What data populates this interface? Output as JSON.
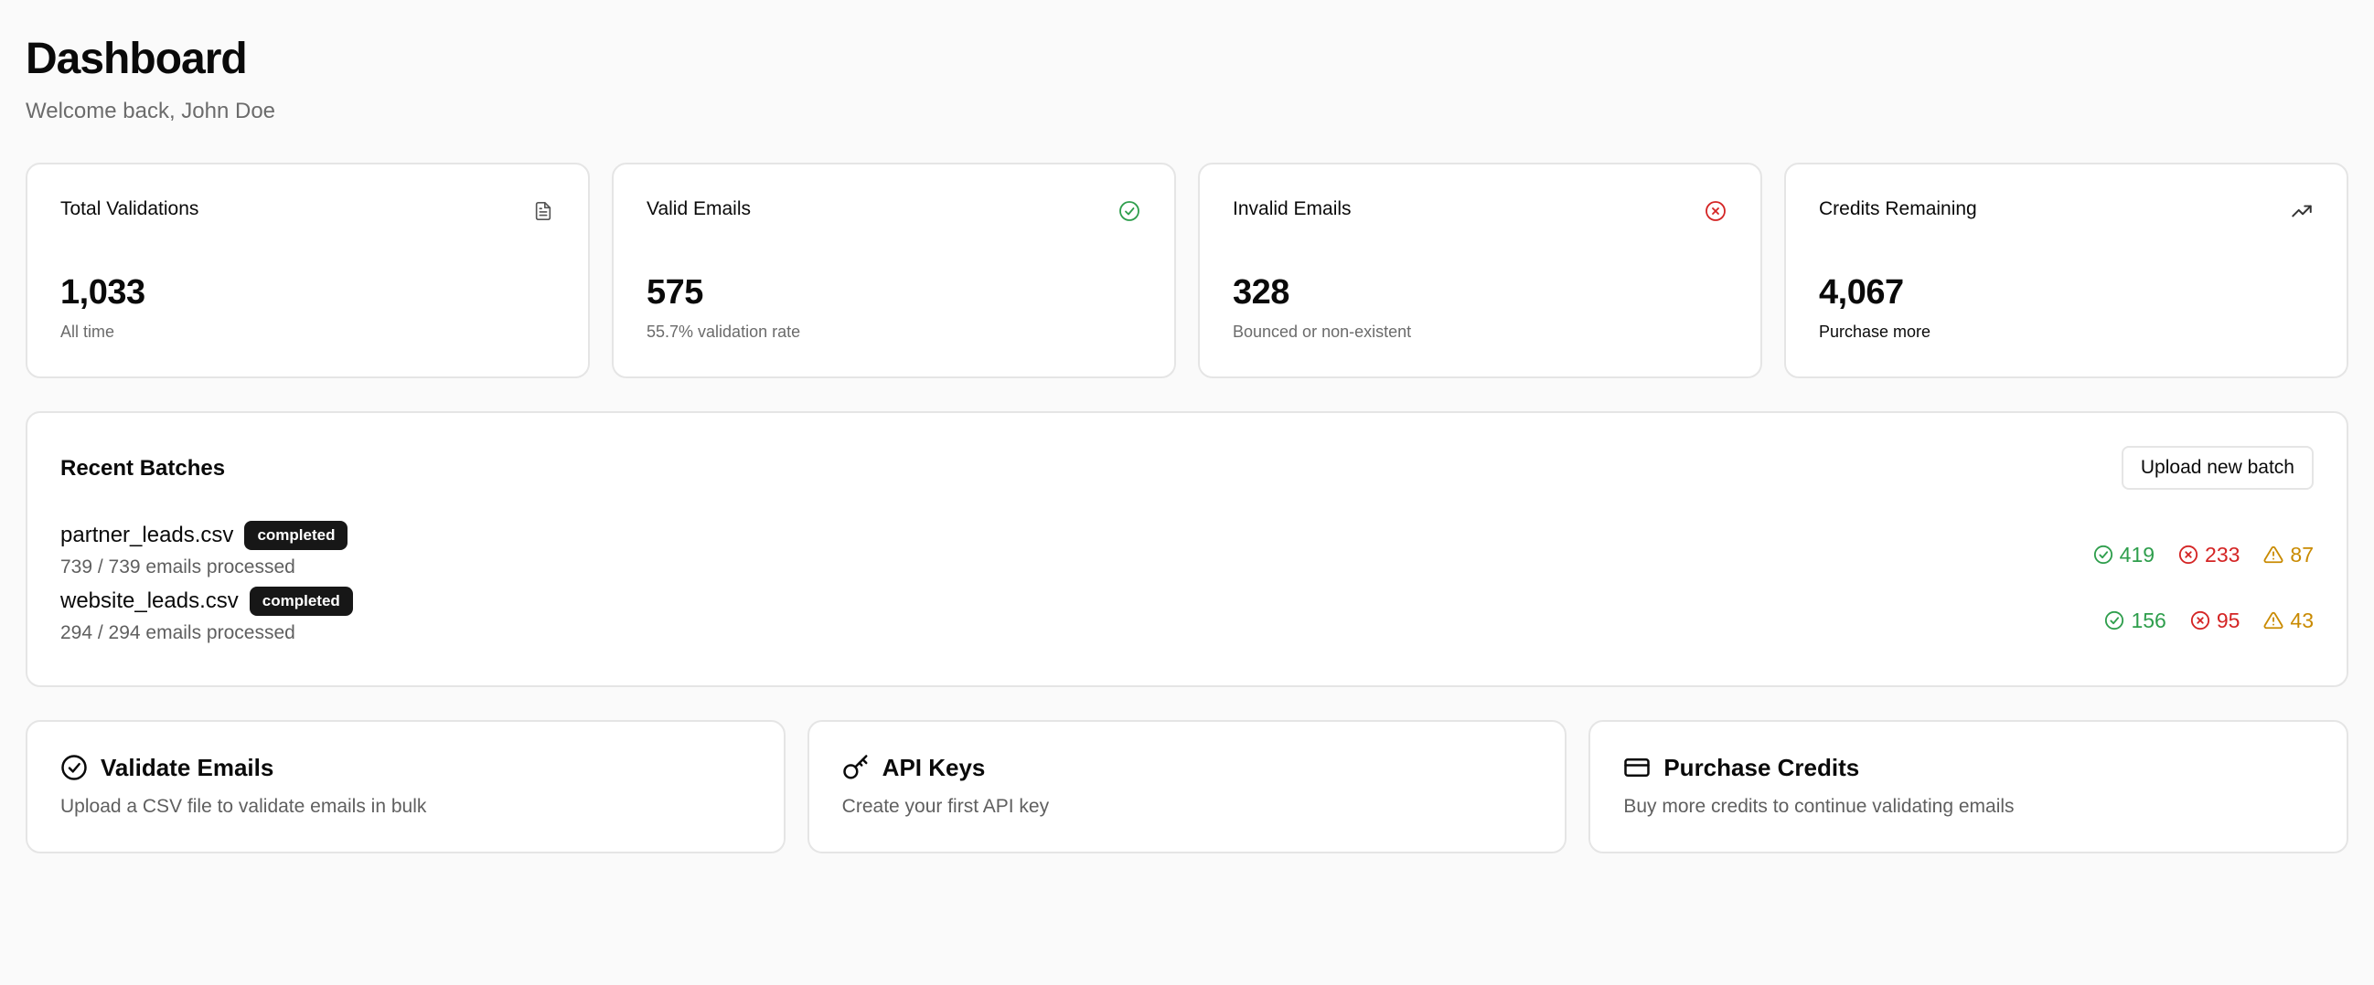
{
  "header": {
    "title": "Dashboard",
    "subtitle": "Welcome back, John Doe"
  },
  "stats": [
    {
      "title": "Total Validations",
      "value": "1,033",
      "sub": "All time",
      "icon": "document-icon"
    },
    {
      "title": "Valid Emails",
      "value": "575",
      "sub": "55.7% validation rate",
      "icon": "check-circle-icon",
      "color": "#2e9e4c"
    },
    {
      "title": "Invalid Emails",
      "value": "328",
      "sub": "Bounced or non-existent",
      "icon": "x-circle-icon",
      "color": "#d42424"
    },
    {
      "title": "Credits Remaining",
      "value": "4,067",
      "link": "Purchase more",
      "icon": "trending-up-icon"
    }
  ],
  "batches": {
    "title": "Recent Batches",
    "upload_label": "Upload new batch",
    "items": [
      {
        "name": "partner_leads.csv",
        "status": "completed",
        "progress": "739 / 739 emails processed",
        "valid": "419",
        "invalid": "233",
        "risky": "87"
      },
      {
        "name": "website_leads.csv",
        "status": "completed",
        "progress": "294 / 294 emails processed",
        "valid": "156",
        "invalid": "95",
        "risky": "43"
      }
    ]
  },
  "actions": [
    {
      "title": "Validate Emails",
      "desc": "Upload a CSV file to validate emails in bulk",
      "icon": "check-circle-icon"
    },
    {
      "title": "API Keys",
      "desc": "Create your first API key",
      "icon": "key-icon"
    },
    {
      "title": "Purchase Credits",
      "desc": "Buy more credits to continue validating emails",
      "icon": "credit-card-icon"
    }
  ],
  "colors": {
    "valid": "#2e9e4c",
    "invalid": "#d42424",
    "risky": "#c98a00",
    "badge_bg": "#171717"
  }
}
